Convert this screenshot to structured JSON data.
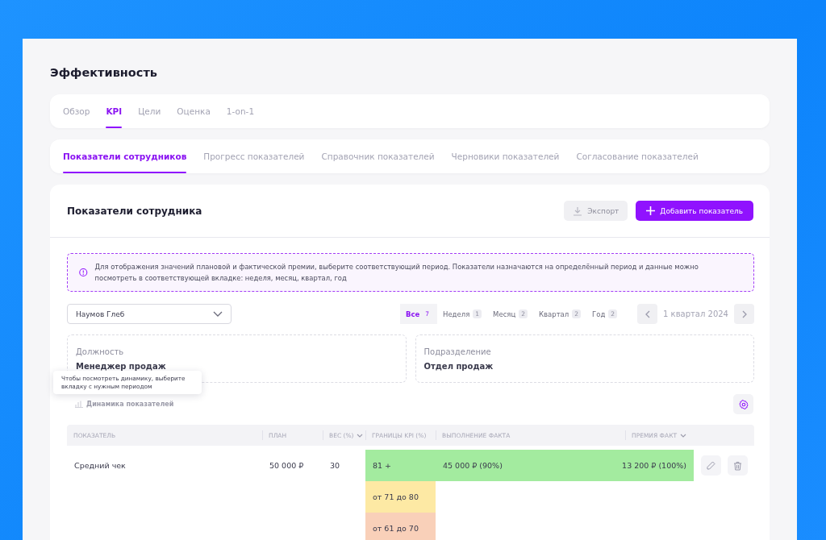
{
  "page_title": "Эффективность",
  "tabs": [
    {
      "label": "Обзор",
      "selected": false
    },
    {
      "label": "KPI",
      "selected": true
    },
    {
      "label": "Цели",
      "selected": false
    },
    {
      "label": "Оценка",
      "selected": false
    },
    {
      "label": "1-on-1",
      "selected": false
    }
  ],
  "subtabs": [
    {
      "label": "Показатели сотрудников",
      "selected": true
    },
    {
      "label": "Прогресс показателей",
      "selected": false
    },
    {
      "label": "Справочник показателей",
      "selected": false
    },
    {
      "label": "Черновики показателей",
      "selected": false
    },
    {
      "label": "Согласование показателей",
      "selected": false
    }
  ],
  "section": {
    "title": "Показатели сотрудника",
    "buttons": [
      {
        "kind": "export",
        "label": "Экспорт",
        "disabled": true
      },
      {
        "kind": "add",
        "label": "Добавить показатель",
        "disabled": false
      }
    ]
  },
  "notice": "Для отображения значений плановой и фактической премии, выберите соответствующий период. Показатели назначаются на определённый период и данные можно посмотреть в соответствующей вкладке: неделя, месяц, квартал, год",
  "employee_select": {
    "value": "Наумов Глеб"
  },
  "periods": [
    {
      "label": "Все",
      "count": "7",
      "selected": true
    },
    {
      "label": "Неделя",
      "count": "1",
      "selected": false
    },
    {
      "label": "Месяц",
      "count": "2",
      "selected": false
    },
    {
      "label": "Квартал",
      "count": "2",
      "selected": false
    },
    {
      "label": "Год",
      "count": "2",
      "selected": false
    }
  ],
  "period_nav": {
    "label": "1 квартал 2024"
  },
  "info_cards": [
    {
      "label": "Должность",
      "value": "Менеджер продаж"
    },
    {
      "label": "Подразделение",
      "value": "Отдел продаж"
    }
  ],
  "tooltip": "Чтобы посмотреть динамику, выберите вкладку с нужным периодом",
  "dynamics_button": {
    "label": "Динамика показателей",
    "disabled": true
  },
  "table": {
    "columns": [
      {
        "label": "ПОКАЗАТЕЛЬ",
        "sortable": false
      },
      {
        "label": "ПЛАН",
        "sortable": false
      },
      {
        "label": "ВЕС (%)",
        "sortable": true
      },
      {
        "label": "ГРАНИЦЫ KPI (%)",
        "sortable": false
      },
      {
        "label": "ВЫПОЛНЕНИЕ ФАКТА",
        "sortable": false
      },
      {
        "label": "ПРЕМИЯ ФАКТ",
        "sortable": true
      }
    ],
    "rows": [
      {
        "name": "Средний чек",
        "plan": "50 000 ₽",
        "weight": "30",
        "fact": "45 000 ₽ (90%)",
        "bonus": "13 200 ₽ (100%)",
        "color": "#a3eb9f",
        "ranges": [
          {
            "label": "81 +",
            "color": "#a3eb9f"
          },
          {
            "label": "от 71 до 80",
            "color": "#fde9a4"
          },
          {
            "label": "от 61 до 70",
            "color": "#f9d0b9"
          }
        ]
      }
    ]
  }
}
